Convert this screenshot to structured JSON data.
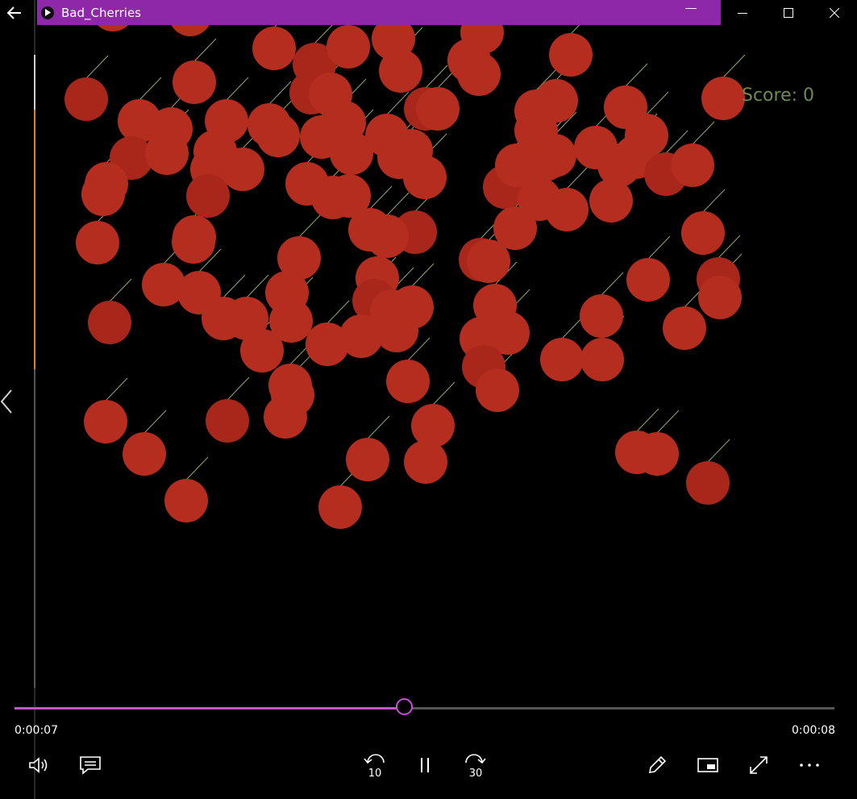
{
  "window": {
    "title": "Bad_Cherries",
    "title_bar_color": "#8e28a8",
    "accent_color": "#c94fd6"
  },
  "game": {
    "score_text": "Score: 0",
    "score_color": "#6f8a4f",
    "cherry_color": "#b52d1f",
    "stem_color": "#8fa86a"
  },
  "player": {
    "time_elapsed": "0:00:07",
    "time_total": "0:00:08",
    "progress_fraction": 0.475,
    "skip_back_label": "10",
    "skip_forward_label": "30"
  },
  "icons": {
    "back": "back-arrow-icon",
    "minimize": "minimize-icon",
    "maximize": "maximize-icon",
    "close": "close-icon",
    "volume": "volume-icon",
    "subtitles": "subtitles-icon",
    "skip_back": "skip-back-10-icon",
    "pause": "pause-icon",
    "skip_forward": "skip-forward-30-icon",
    "edit": "pencil-icon",
    "mini_view": "mini-view-icon",
    "fullscreen": "fullscreen-icon",
    "more": "more-icon"
  }
}
